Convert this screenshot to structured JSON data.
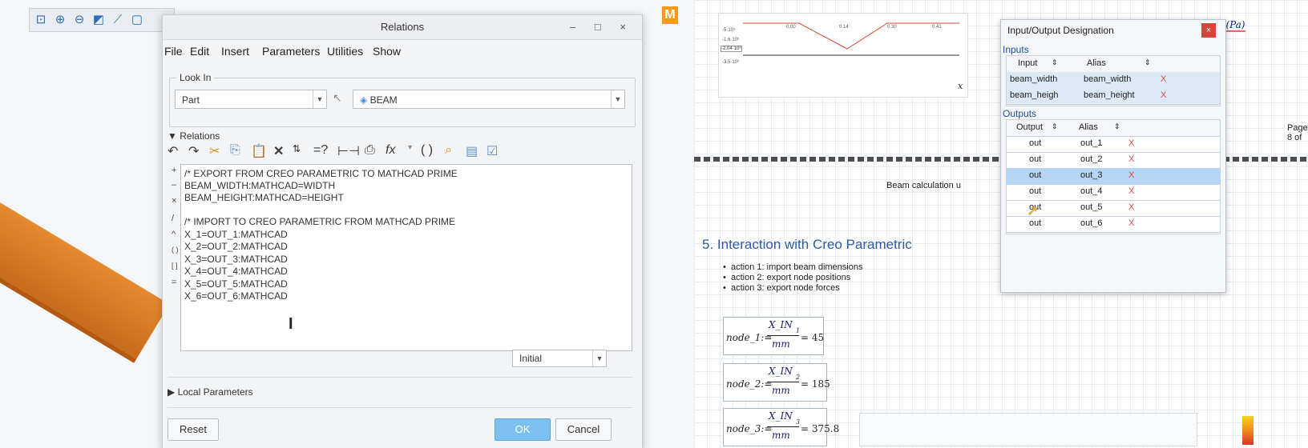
{
  "relations_dialog": {
    "title": "Relations",
    "window_controls": "– □ ×",
    "menu": [
      "File",
      "Edit",
      "Insert",
      "Parameters",
      "Utilities",
      "Show"
    ],
    "look_in_label": "Look In",
    "look_in_type": "Part",
    "look_in_model": "BEAM",
    "relations_label": "Relations",
    "code_lines": [
      "/* EXPORT FROM CREO PARAMETRIC TO MATHCAD PRIME",
      "BEAM_WIDTH:MATHCAD=WIDTH",
      "BEAM_HEIGHT:MATHCAD=HEIGHT",
      "",
      "/* IMPORT TO CREO PARAMETRIC FROM MATHCAD PRIME",
      "X_1=OUT_1:MATHCAD",
      "X_2=OUT_2:MATHCAD",
      "X_3=OUT_3:MATHCAD",
      "X_4=OUT_4:MATHCAD",
      "X_5=OUT_5:MATHCAD",
      "X_6=OUT_6:MATHCAD"
    ],
    "gutter": [
      "+",
      "–",
      "×",
      "/",
      "^",
      "( )",
      "[ ]",
      "="
    ],
    "units_select": "Initial",
    "local_parameters_label": "Local Parameters",
    "reset_label": "Reset",
    "ok_label": "OK",
    "cancel_label": "Cancel"
  },
  "mathcad": {
    "logo": "M",
    "page_label": "Page 8 of",
    "beam_caption": "Beam calculation u",
    "sigma_header": "σmax(x) (Pa)",
    "section_title": "5. Interaction with Creo Parametric",
    "bullets": [
      "action 1: import beam dimensions",
      "action 2: export node positions",
      "action 3: export node forces"
    ],
    "equations": [
      {
        "lhs": "node_1:=",
        "num": "X_IN",
        "sub": "1",
        "den": "mm",
        "result": "= 45"
      },
      {
        "lhs": "node_2:=",
        "num": "X_IN",
        "sub": "2",
        "den": "mm",
        "result": "= 185"
      },
      {
        "lhs": "node_3:=",
        "num": "X_IN",
        "sub": "3",
        "den": "mm",
        "result": "= 375.8"
      }
    ],
    "plot_labels": {
      "x_ticks": [
        "0.00",
        "0.14",
        "0.30",
        "0.41"
      ],
      "y_ticks": [
        "-5·10⁵",
        "-1.6·10⁶",
        "-2.04·10⁶",
        "-3.5·10⁶"
      ],
      "x_axis": "x"
    }
  },
  "io_panel": {
    "title": "Input/Output Designation",
    "inputs_label": "Inputs",
    "input_headers": [
      "Input",
      "Alias"
    ],
    "inputs": [
      {
        "input": "beam_width",
        "alias": "beam_width"
      },
      {
        "input": "beam_heigh",
        "alias": "beam_height"
      }
    ],
    "outputs_label": "Outputs",
    "output_headers": [
      "Output",
      "Alias"
    ],
    "outputs": [
      {
        "output": "out",
        "alias": "out_1"
      },
      {
        "output": "out",
        "alias": "out_2"
      },
      {
        "output": "out",
        "alias": "out_3"
      },
      {
        "output": "out",
        "alias": "out_4"
      },
      {
        "output": "out",
        "alias": "out_5"
      },
      {
        "output": "out",
        "alias": "out_6"
      }
    ],
    "selected_output_index": 2,
    "remove_glyph": "X"
  },
  "colors": {
    "accent": "#2f5aa6",
    "beam_orange": "#d9782a",
    "remove_red": "#d9443a",
    "selection_blue": "#b6d5f5",
    "ok_blue": "#7cc0ef"
  }
}
